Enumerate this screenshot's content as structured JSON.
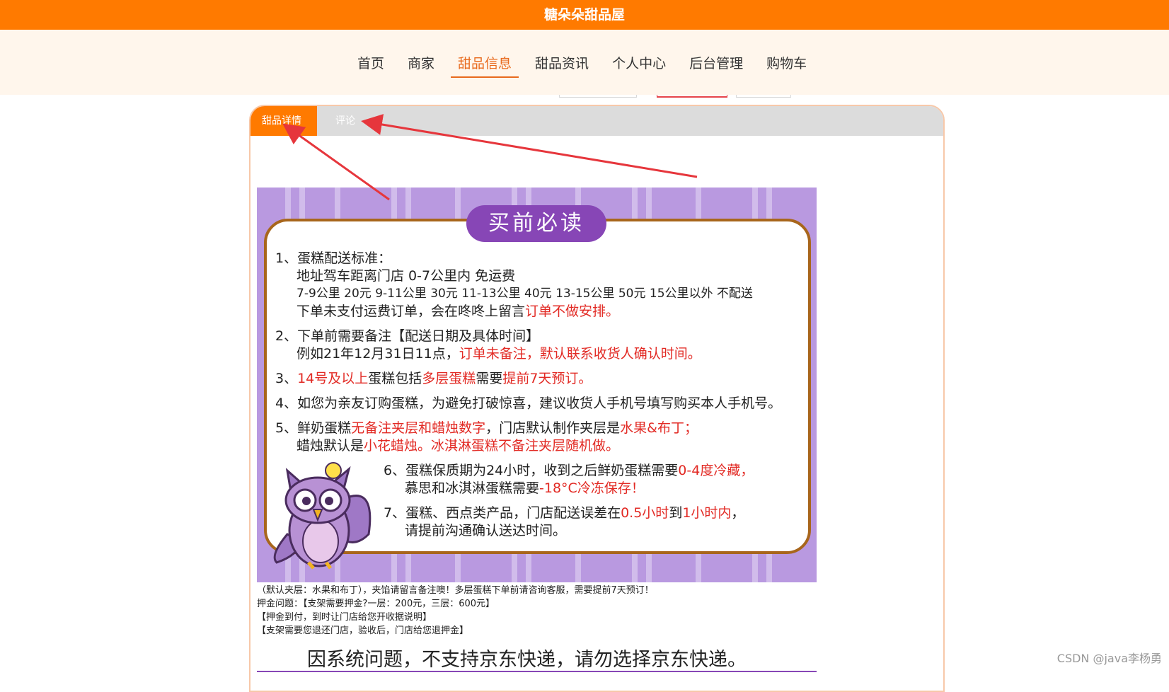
{
  "site": {
    "title": "糖朵朵甜品屋"
  },
  "nav": [
    "首页",
    "商家",
    "甜品信息",
    "甜品资讯",
    "个人中心",
    "后台管理",
    "购物车"
  ],
  "tabs": {
    "detail": "甜品详情",
    "comment": "评论"
  },
  "banner": {
    "heading": "买前必读",
    "r1_title": "1、蛋糕配送标准：",
    "r1_l1": "地址驾车距离门店 0-7公里内 免运费",
    "r1_l2": "7-9公里 20元 9-11公里 30元 11-13公里 40元 13-15公里 50元 15公里以外 不配送",
    "r1_l3a": "下单未支付运费订单，会在咚咚上留言",
    "r1_l3b": "订单不做安排。",
    "r2_title": "2、下单前需要备注【配送日期及具体时间】",
    "r2_l1a": "例如21年12月31日11点，",
    "r2_l1b": "订单未备注，默认联系收货人确认时间。",
    "r3_a": "3、",
    "r3_b": "14号及以上",
    "r3_c": "蛋糕包括",
    "r3_d": "多层蛋糕",
    "r3_e": "需要",
    "r3_f": "提前7天预订。",
    "r4": "4、如您为亲友订购蛋糕，为避免打破惊喜，建议收货人手机号填写购买本人手机号。",
    "r5_a": "5、鲜奶蛋糕",
    "r5_b": "无备注夹层和蜡烛数字",
    "r5_c": "，门店默认制作夹层是",
    "r5_d": "水果&布丁；",
    "r5_l2a": "蜡烛默认是",
    "r5_l2b": "小花蜡烛。冰淇淋蛋糕不备注夹层随机做。",
    "r6_a": "6、蛋糕保质期为24小时，收到之后鲜奶蛋糕需要",
    "r6_b": "0-4度冷藏，",
    "r6_l2a": "慕思和冰淇淋蛋糕需要",
    "r6_l2b": "-18°C冷冻保存！",
    "r7_a": "7、蛋糕、西点类产品，门店配送误差在",
    "r7_b": "0.5小时",
    "r7_c": "到",
    "r7_d": "1小时内",
    "r7_e": "，",
    "r7_l2": "请提前沟通确认送达时间。"
  },
  "notes": {
    "n1": "（默认夹层：水果和布丁），夹馅请留言备注噢！多层蛋糕下单前请咨询客服，需要提前7天预订！",
    "n2": "押金问题：【支架需要押金?一层：200元，三层：600元】",
    "n3": "【押金到付，到时让门店给您开收据说明】",
    "n4": "【支架需要您退还门店，验收后，门店给您退押金】",
    "big": "因系统问题，不支持京东快递，请勿选择京东快递。"
  },
  "watermark": "CSDN @java李杨勇",
  "colors": {
    "brand": "#ff7a00",
    "active_nav": "#e86a1d",
    "banner_bg": "#b999e0",
    "accent_purple": "#8746b6",
    "highlight_red": "#e22a24"
  }
}
